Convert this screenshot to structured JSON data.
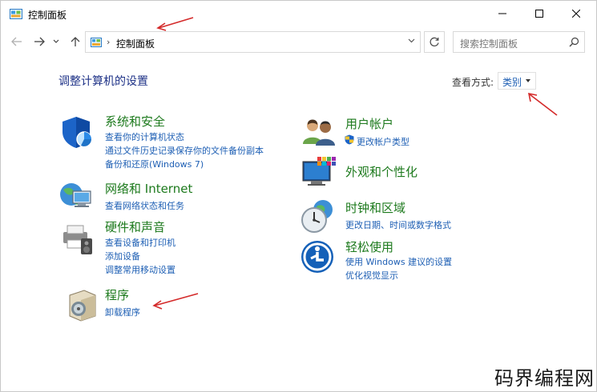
{
  "window": {
    "title": "控制面板"
  },
  "address": {
    "path": "控制面板",
    "separator": "›"
  },
  "search": {
    "placeholder": "搜索控制面板"
  },
  "content": {
    "heading": "调整计算机的设置",
    "view_by_label": "查看方式:",
    "view_by_value": "类别"
  },
  "categories": [
    {
      "id": "system-security",
      "title": "系统和安全",
      "links": [
        "查看你的计算机状态",
        "通过文件历史记录保存你的文件备份副本",
        "备份和还原(Windows 7)"
      ]
    },
    {
      "id": "network-internet",
      "title": "网络和 Internet",
      "links": [
        "查看网络状态和任务"
      ]
    },
    {
      "id": "hardware-sound",
      "title": "硬件和声音",
      "links": [
        "查看设备和打印机",
        "添加设备",
        "调整常用移动设置"
      ]
    },
    {
      "id": "programs",
      "title": "程序",
      "links": [
        "卸载程序"
      ]
    },
    {
      "id": "user-accounts",
      "title": "用户帐户",
      "links": [
        "更改帐户类型"
      ]
    },
    {
      "id": "appearance",
      "title": "外观和个性化",
      "links": []
    },
    {
      "id": "clock-region",
      "title": "时钟和区域",
      "links": [
        "更改日期、时间或数字格式"
      ]
    },
    {
      "id": "ease-of-access",
      "title": "轻松使用",
      "links": [
        "使用 Windows 建议的设置",
        "优化视觉显示"
      ]
    }
  ],
  "watermark": "码界编程网",
  "colors": {
    "category_title": "#1d7a1d",
    "link": "#1e5fb4",
    "heading": "#1e3287",
    "annotation_arrow": "#d42a2a"
  }
}
